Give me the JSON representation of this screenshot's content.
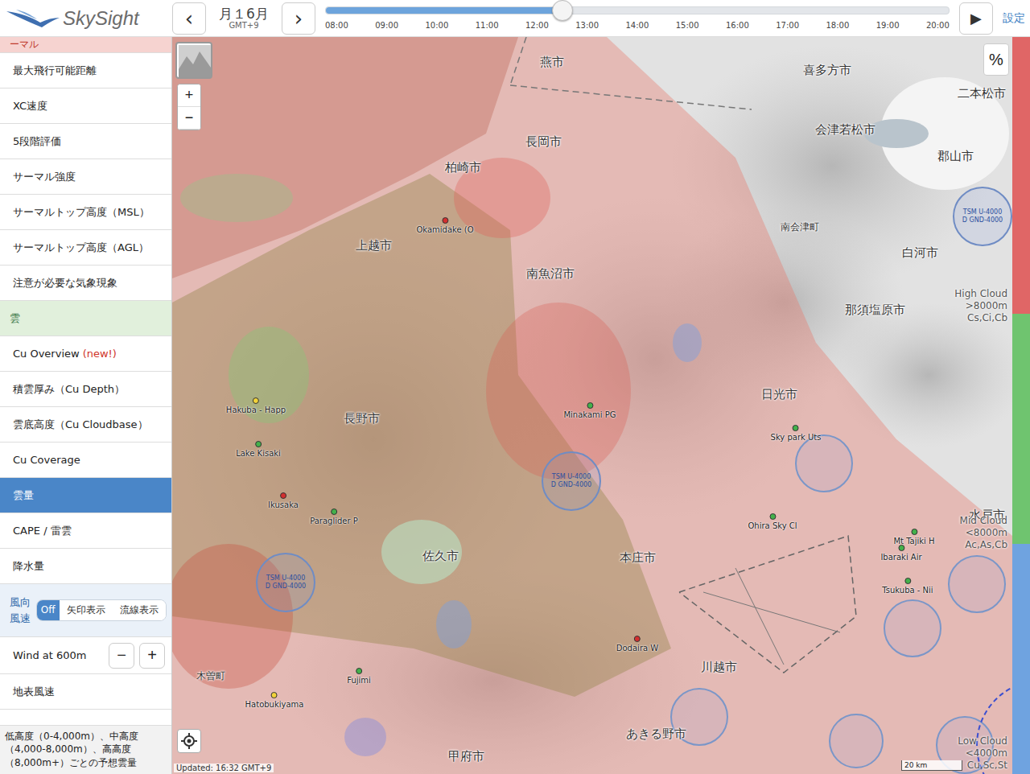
{
  "app": {
    "logo": "SkySight",
    "settings": "設定",
    "play": "▶"
  },
  "date_nav": {
    "prev": "‹",
    "next": "›",
    "date": "月１6月",
    "timezone": "GMT+9"
  },
  "timeline": {
    "ticks": [
      "08:00",
      "09:00",
      "10:00",
      "11:00",
      "12:00",
      "13:00",
      "14:00",
      "15:00",
      "16:00",
      "17:00",
      "18:00",
      "19:00",
      "20:00"
    ],
    "level": 0.38
  },
  "sidebar": {
    "items": [
      {
        "label": "ーマル",
        "kind": "header",
        "color": "#f6d3d0",
        "selected": false
      },
      {
        "label": "最大飛行可能距離",
        "kind": "item",
        "selected": false
      },
      {
        "label": "XC速度",
        "kind": "item",
        "selected": false
      },
      {
        "label": "5段階評価",
        "kind": "item",
        "selected": false
      },
      {
        "label": "サーマル強度",
        "kind": "item",
        "selected": false
      },
      {
        "label": "サーマルトップ高度（MSL）",
        "kind": "item",
        "selected": false
      },
      {
        "label": "サーマルトップ高度（AGL）",
        "kind": "item",
        "selected": false
      },
      {
        "label": "注意が必要な気象現象",
        "kind": "item",
        "selected": false
      },
      {
        "label": "雲",
        "kind": "header",
        "color": "#e1f0dc",
        "selected": false
      },
      {
        "label": "Cu Overview",
        "kind": "item",
        "selected": false,
        "badge": "(new!)"
      },
      {
        "label": "積雲厚み（Cu Depth）",
        "kind": "item",
        "selected": false
      },
      {
        "label": "雲底高度（Cu Cloudbase）",
        "kind": "item",
        "selected": false
      },
      {
        "label": "Cu Coverage",
        "kind": "item",
        "selected": false
      },
      {
        "label": "雲量",
        "kind": "item",
        "selected": true
      },
      {
        "label": "CAPE / 雷雲",
        "kind": "item",
        "selected": false
      },
      {
        "label": "降水量",
        "kind": "item",
        "selected": false
      }
    ],
    "wind": {
      "label": "風向風速",
      "options": [
        {
          "label": "Off",
          "selected": true
        },
        {
          "label": "矢印表示",
          "selected": false
        },
        {
          "label": "流線表示",
          "selected": false
        }
      ]
    },
    "wind_height": {
      "label": "Wind at 600m",
      "minus": "−",
      "plus": "+"
    },
    "more_items": [
      {
        "label": "地表風速",
        "selected": false
      }
    ],
    "footer": "低高度（0-4,000m）、中高度（4,000-8,000m）、高高度（8,000m+）ごとの予想雲量"
  },
  "map": {
    "cities": [
      "燕市",
      "長岡市",
      "柏崎市",
      "上越市",
      "南魚沼市",
      "長野市",
      "佐久市",
      "本庄市",
      "川越市",
      "あきる野市",
      "甲府市",
      "日光市",
      "那須塩原市",
      "白河市",
      "郡山市",
      "会津若松市",
      "喜多方市",
      "二本松市",
      "南会津町",
      "木曽町",
      "水戸市"
    ],
    "sites": [
      {
        "name": "Okamidake (O",
        "color": "#d32f2f"
      },
      {
        "name": "Hakuba - Happ",
        "color": "#f2d33a"
      },
      {
        "name": "Lake Kisaki",
        "color": "#43b14b"
      },
      {
        "name": "Ikusaka",
        "color": "#d32f2f"
      },
      {
        "name": "Paraglider P",
        "color": "#43b14b"
      },
      {
        "name": "Minakami PG",
        "color": "#43b14b"
      },
      {
        "name": "Sky park Uts",
        "color": "#43b14b"
      },
      {
        "name": "Ohira Sky Cl",
        "color": "#43b14b"
      },
      {
        "name": "Mt Tajiki H",
        "color": "#43b14b"
      },
      {
        "name": "Ibaraki Air",
        "color": "#43b14b"
      },
      {
        "name": "Tsukuba - Nii",
        "color": "#43b14b"
      },
      {
        "name": "Dodaira W",
        "color": "#d32f2f"
      },
      {
        "name": "Fujimi",
        "color": "#43b14b"
      },
      {
        "name": "Hatobukiyama",
        "color": "#f2d33a"
      }
    ],
    "airspaces": [
      [
        "TSM U-4000",
        "D GND-4000"
      ],
      [
        "TSM U-4000",
        "D GND-4000"
      ],
      [
        "TSM U-4000",
        "D GND-4000"
      ]
    ],
    "legend": [
      {
        "lines": [
          "High Cloud",
          ">8000m",
          "Cs,Ci,Cb"
        ],
        "color": "#e06666"
      },
      {
        "lines": [
          "Mid Cloud",
          "<8000m",
          "Ac,As,Cb"
        ],
        "color": "#6fc46f"
      },
      {
        "lines": [
          "Low Cloud",
          "<4000m",
          "Cu,Sc,St"
        ],
        "color": "#6fa3e0"
      }
    ],
    "zoom_in": "+",
    "zoom_out": "−",
    "percent": "%",
    "scale": "20 km",
    "updated": "Updated: 16:32 GMT+9"
  }
}
